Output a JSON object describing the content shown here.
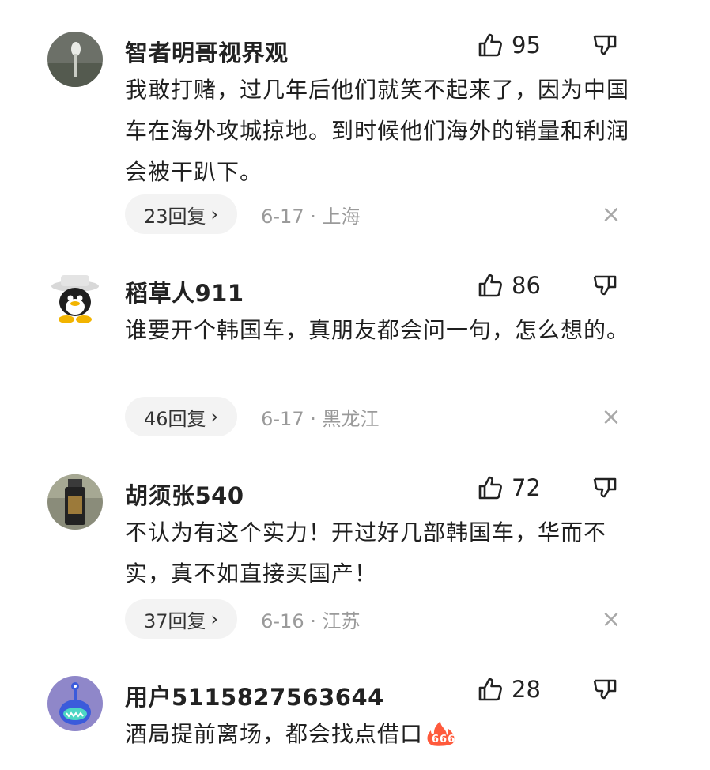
{
  "comments": [
    {
      "username": "智者明哥视界观",
      "likes": "95",
      "text": "我敢打赌，过几年后他们就笑不起来了，因为中国车在海外攻城掠地。到时候他们海外的销量和利润会被干趴下。",
      "replies": "23回复",
      "date_location": "6-17 · 上海"
    },
    {
      "username": "稻草人911",
      "likes": "86",
      "text": "谁要开个韩国车，真朋友都会问一句，怎么想的。",
      "replies": "46回复",
      "date_location": "6-17 · 黑龙江"
    },
    {
      "username": "胡须张540",
      "likes": "72",
      "text": "不认为有这个实力！开过好几部韩国车，华而不实，真不如直接买国产！",
      "replies": "37回复",
      "date_location": "6-16 · 江苏"
    },
    {
      "username": "用户5115827563644",
      "likes": "28",
      "text": "酒局提前离场，都会找点借口"
    }
  ],
  "icons": {
    "like": "thumbs-up-outline",
    "dislike": "thumbs-down-outline",
    "close": "close-x",
    "emoji": "fire-666-emoji"
  },
  "colors": {
    "meta_gray": "#9a9a9a",
    "pill_bg": "#f3f3f3"
  }
}
